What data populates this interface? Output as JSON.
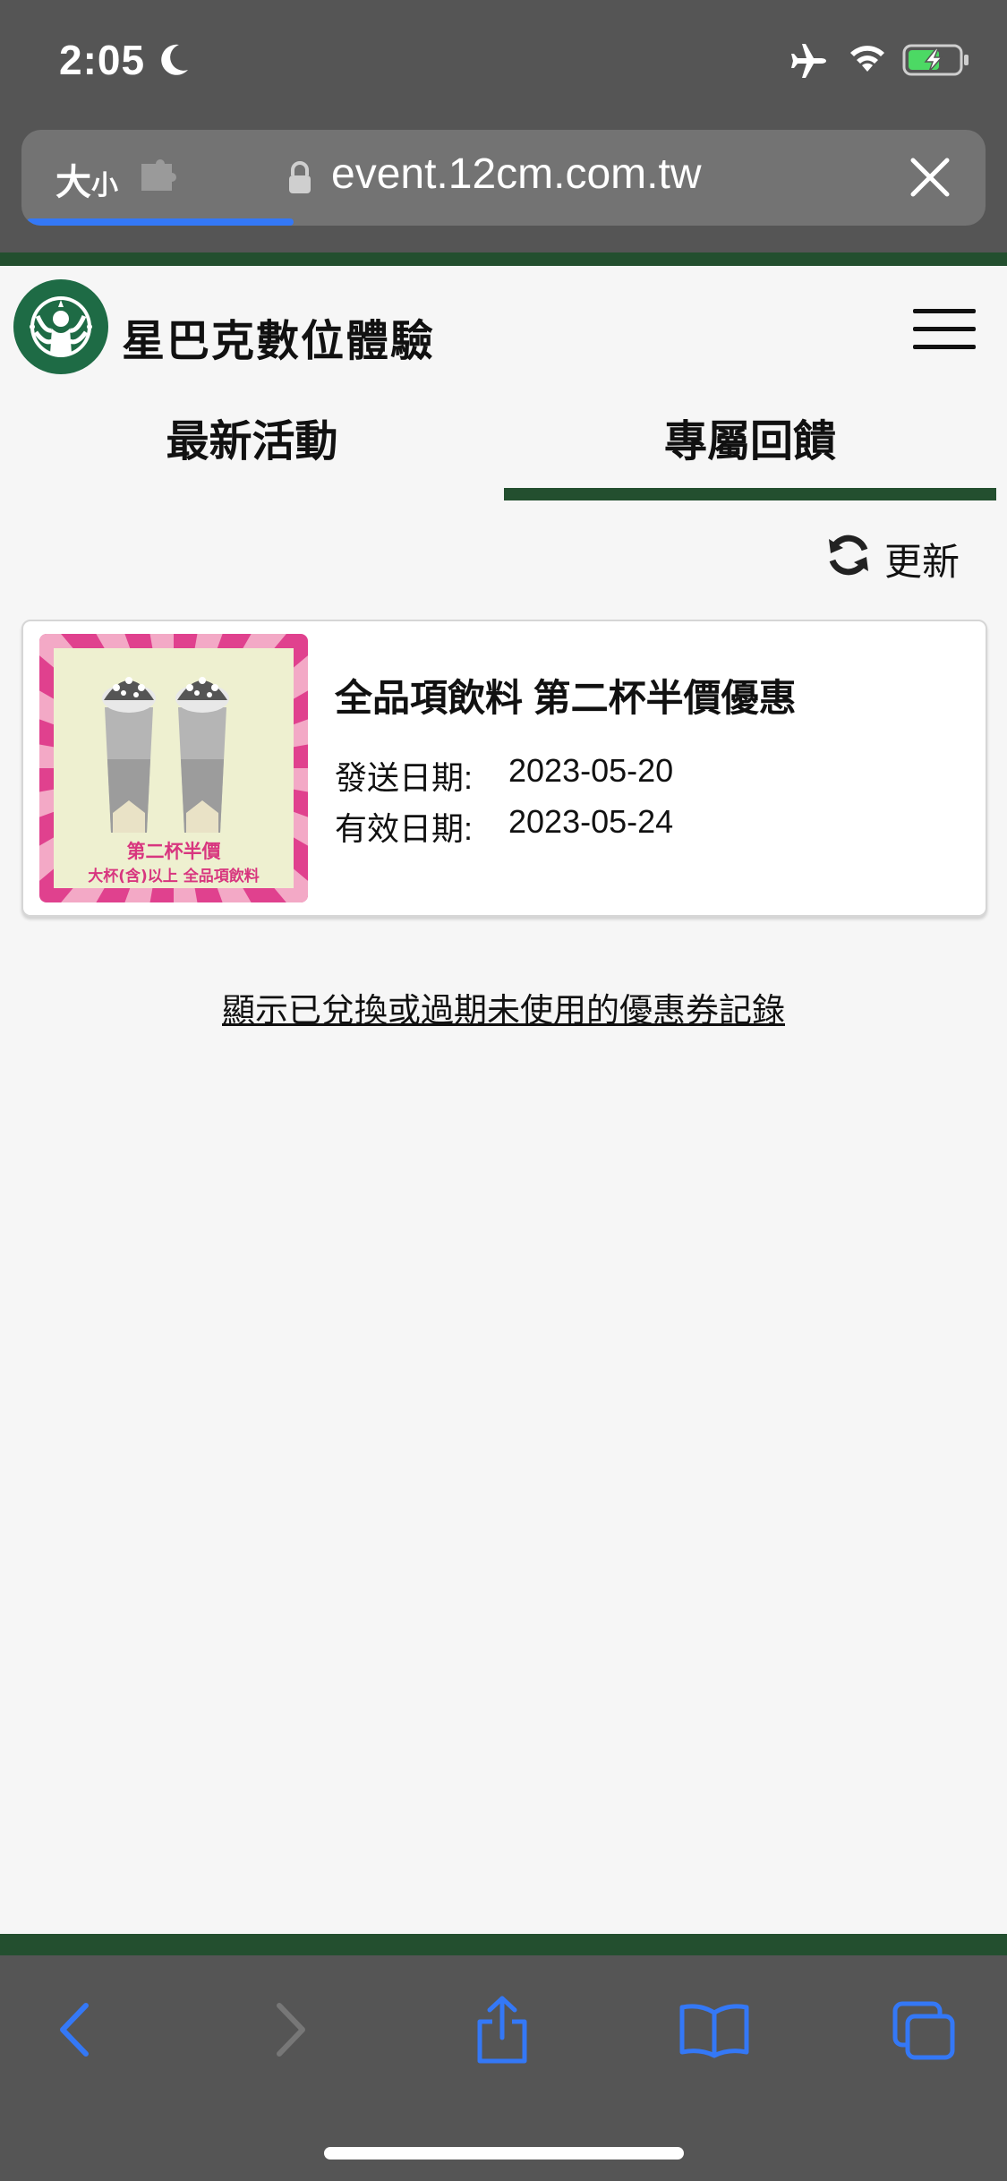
{
  "status_bar": {
    "time": "2:05",
    "icons": [
      "moon-icon",
      "airplane-icon",
      "wifi-icon",
      "battery-charging-icon"
    ]
  },
  "browser": {
    "text_size_large": "大",
    "text_size_small": "小",
    "url": "event.12cm.com.tw",
    "load_progress": 0.28,
    "accent_color": "#3478f6"
  },
  "site": {
    "title": "星巴克數位體驗",
    "brand_color": "#234f2f"
  },
  "tabs": [
    {
      "label": "最新活動",
      "active": false
    },
    {
      "label": "專屬回饋",
      "active": true
    }
  ],
  "refresh_label": "更新",
  "coupons": [
    {
      "title": "全品項飲料 第二杯半價優惠",
      "send_label": "發送日期:",
      "send_date": "2023-05-20",
      "valid_label": "有效日期:",
      "valid_date": "2023-05-24",
      "image_text_main": "第二杯半價",
      "image_text_sub": "大杯(含)以上 全品項飲料"
    }
  ],
  "history_link": "顯示已兌換或過期未使用的優惠券記錄",
  "toolbar_icons": [
    "back-icon",
    "forward-icon",
    "share-icon",
    "bookmarks-icon",
    "tabs-icon"
  ]
}
